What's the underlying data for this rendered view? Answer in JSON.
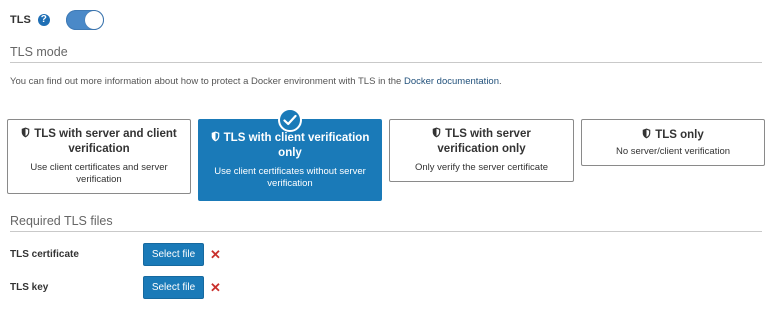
{
  "tls_toggle": {
    "label": "TLS",
    "help_icon": "question-circle",
    "enabled": true
  },
  "tls_mode": {
    "section_title": "TLS mode",
    "info_prefix": "You can find out more information about how to protect a Docker environment with TLS in the ",
    "info_link": "Docker documentation",
    "info_suffix": ".",
    "options": [
      {
        "title": "TLS with server and client verification",
        "description": "Use client certificates and server verification",
        "selected": false,
        "icon": "shield-icon"
      },
      {
        "title": "TLS with client verification only",
        "description": "Use client certificates without server verification",
        "selected": true,
        "icon": "shield-icon"
      },
      {
        "title": "TLS with server verification only",
        "description": "Only verify the server certificate",
        "selected": false,
        "icon": "shield-icon"
      },
      {
        "title": "TLS only",
        "description": "No server/client verification",
        "selected": false,
        "icon": "shield-icon"
      }
    ]
  },
  "required_files": {
    "section_title": "Required TLS files",
    "files": [
      {
        "label": "TLS certificate",
        "button": "Select file",
        "remove_icon": "times-icon"
      },
      {
        "label": "TLS key",
        "button": "Select file",
        "remove_icon": "times-icon"
      }
    ]
  },
  "colors": {
    "accent": "#1a7ab8",
    "toggle": "#4a89c8",
    "remove": "#c9302c",
    "link": "#23527c"
  }
}
